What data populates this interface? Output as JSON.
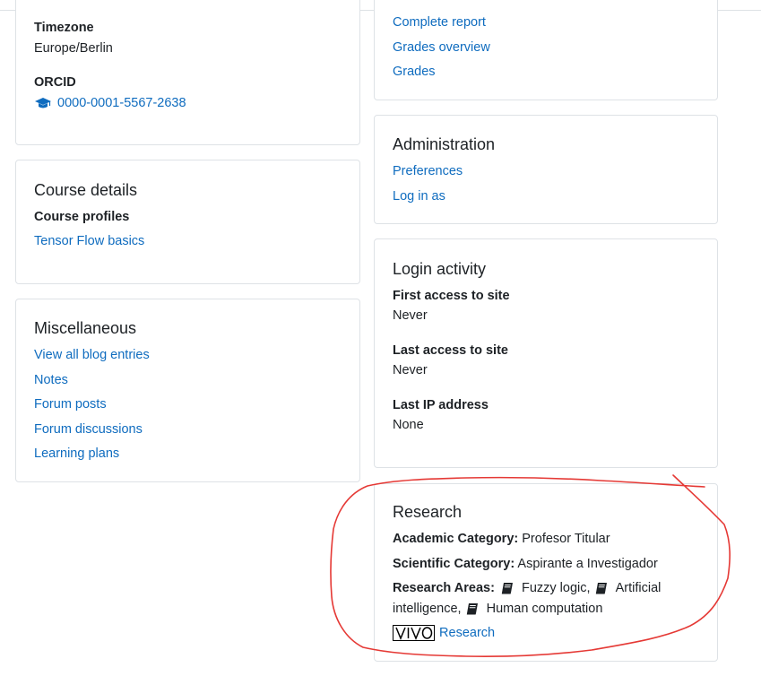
{
  "user_details": {
    "timezone_label": "Timezone",
    "timezone_value": "Europe/Berlin",
    "orcid_label": "ORCID",
    "orcid_value": "0000-0001-5567-2638"
  },
  "course_details": {
    "title": "Course details",
    "profiles_label": "Course profiles",
    "course_link": "Tensor Flow basics"
  },
  "miscellaneous": {
    "title": "Miscellaneous",
    "links": [
      "View all blog entries",
      "Notes",
      "Forum posts",
      "Forum discussions",
      "Learning plans"
    ]
  },
  "reports": {
    "links": [
      "Complete report",
      "Grades overview",
      "Grades"
    ]
  },
  "administration": {
    "title": "Administration",
    "links": [
      "Preferences",
      "Log in as"
    ]
  },
  "login_activity": {
    "title": "Login activity",
    "first_access_label": "First access to site",
    "first_access_value": "Never",
    "last_access_label": "Last access to site",
    "last_access_value": "Never",
    "last_ip_label": "Last IP address",
    "last_ip_value": "None"
  },
  "research": {
    "title": "Research",
    "academic_label": "Academic Category:",
    "academic_value": "Profesor Titular",
    "scientific_label": "Scientific Category:",
    "scientific_value": "Aspirante a Investigador",
    "areas_label": "Research Areas:",
    "area_1": "Fuzzy logic,",
    "area_2_line1": "Artificial",
    "area_2_line2": "intelligence,",
    "area_3": "Human computation",
    "vivo_logo_text": "VIVO",
    "vivo_link": "Research"
  },
  "icons": {
    "orcid": "graduation-cap-icon",
    "research_area": "book-icon"
  },
  "colors": {
    "link": "#0f6cbf",
    "annotation": "#e53935",
    "border": "#dee2e6"
  }
}
